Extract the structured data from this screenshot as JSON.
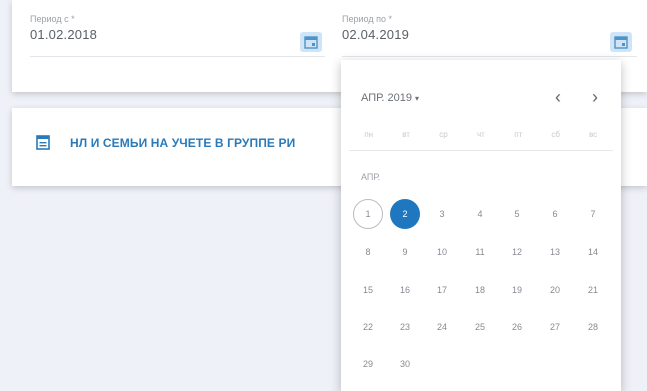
{
  "period_from": {
    "label": "Период с *",
    "value": "01.02.2018"
  },
  "period_to": {
    "label": "Период по *",
    "value": "02.04.2019"
  },
  "section": {
    "title": "НЛ И СЕМЬИ НА УЧЕТЕ В ГРУППЕ РИ"
  },
  "calendar": {
    "month_year": "АПР. 2019",
    "caret": "▾",
    "prev": "‹",
    "next": "›",
    "weekdays": [
      "пн",
      "вт",
      "ср",
      "чт",
      "пт",
      "сб",
      "вс"
    ],
    "month_short": "АПР.",
    "today_day": 1,
    "selected_day": 2,
    "start_weekday": 0,
    "days": [
      "1",
      "2",
      "3",
      "4",
      "5",
      "6",
      "7",
      "8",
      "9",
      "10",
      "11",
      "12",
      "13",
      "14",
      "15",
      "16",
      "17",
      "18",
      "19",
      "20",
      "21",
      "22",
      "23",
      "24",
      "25",
      "26",
      "27",
      "28",
      "29",
      "30"
    ]
  },
  "colors": {
    "accent": "#1f78bf",
    "section_title": "#2a7ab9",
    "calendar_button_bg": "#cfe4f6"
  }
}
